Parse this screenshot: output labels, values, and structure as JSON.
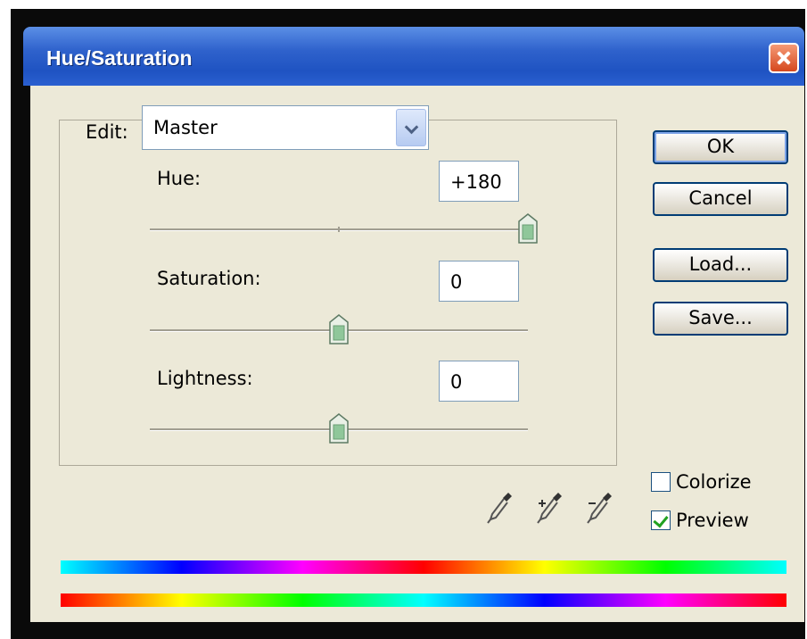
{
  "window": {
    "title": "Hue/Saturation"
  },
  "edit": {
    "label": "Edit:",
    "value": "Master"
  },
  "sliders": [
    {
      "label": "Hue:",
      "value": "+180",
      "min": -180,
      "max": 180,
      "level": 180
    },
    {
      "label": "Saturation:",
      "value": "0",
      "min": -100,
      "max": 100,
      "level": 0
    },
    {
      "label": "Lightness:",
      "value": "0",
      "min": -100,
      "max": 100,
      "level": 0
    }
  ],
  "buttons": {
    "ok": "OK",
    "cancel": "Cancel",
    "load": "Load...",
    "save": "Save..."
  },
  "options": {
    "colorize": {
      "label": "Colorize",
      "checked": false
    },
    "preview": {
      "label": "Preview",
      "checked": true
    }
  },
  "icons": [
    "eyedropper-icon",
    "eyedropper-plus-icon",
    "eyedropper-minus-icon"
  ],
  "colors": {
    "titlebar": "#2f62cc",
    "client": "#ece9d8",
    "check": "#21a121"
  }
}
